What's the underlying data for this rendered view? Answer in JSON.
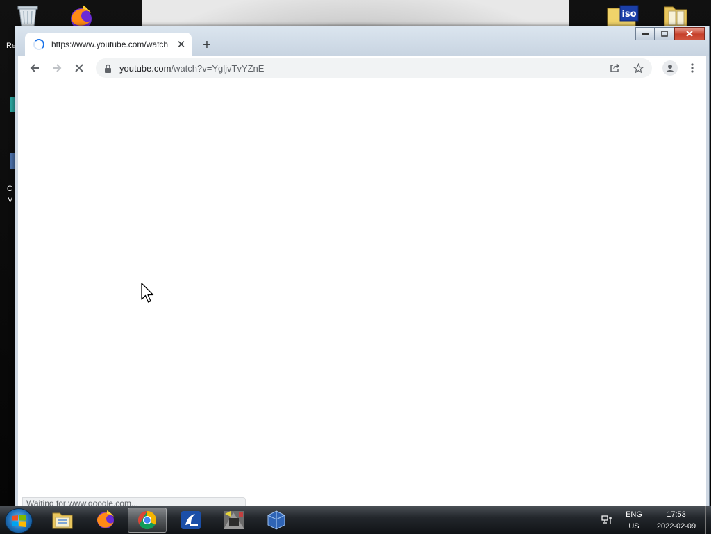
{
  "desktop": {
    "label_fragments": [
      "Re",
      "C",
      "V"
    ]
  },
  "browser": {
    "tab": {
      "title": "https://www.youtube.com/watch"
    },
    "omnibox": {
      "url_host": "youtube.com",
      "url_path": "/watch?v=YgljvTvYZnE"
    },
    "status_text": "Waiting for www.google.com..."
  },
  "taskbar": {
    "apps": [
      "windows-explorer",
      "firefox",
      "google-chrome",
      "setup-app",
      "game-app",
      "virtualbox"
    ],
    "language": "ENG",
    "region": "US",
    "time": "17:53",
    "date": "2022-02-09"
  },
  "colors": {
    "chrome_frame": "#cfd8e3",
    "loading_blue": "#1a73e8",
    "close_red": "#c6402b"
  }
}
